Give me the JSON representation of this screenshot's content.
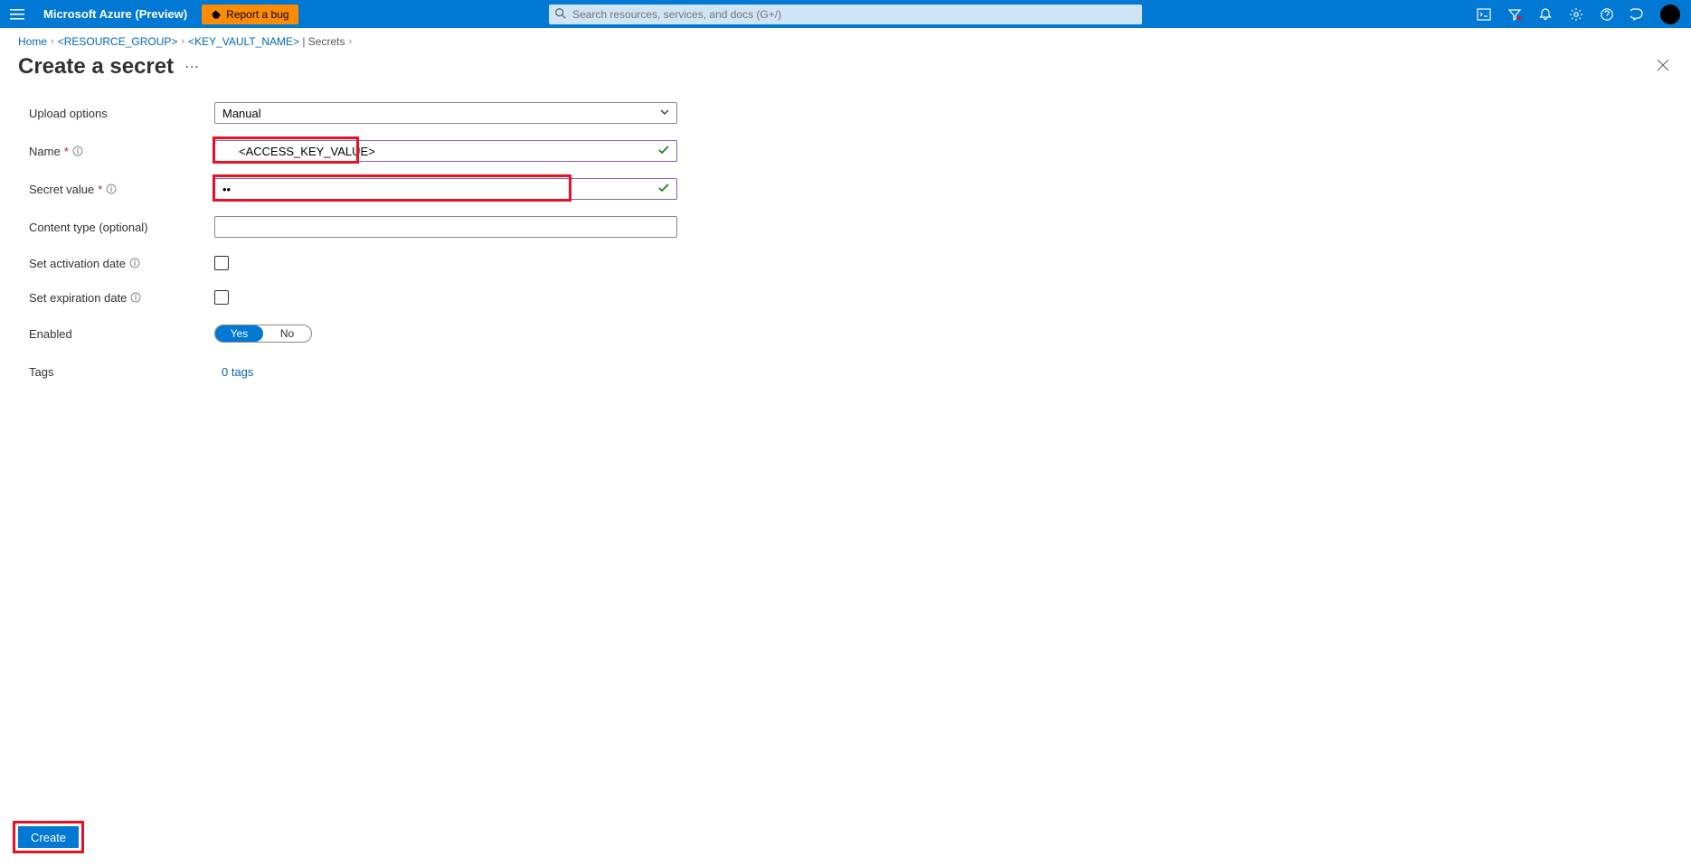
{
  "header": {
    "brand": "Microsoft Azure (Preview)",
    "report_bug": "Report a bug",
    "search_placeholder": "Search resources, services, and docs (G+/)"
  },
  "breadcrumb": {
    "home": "Home",
    "resource_group": "<RESOURCE_GROUP>",
    "key_vault": "<KEY_VAULT_NAME>",
    "secrets_suffix": " | Secrets"
  },
  "page": {
    "title": "Create a secret"
  },
  "form": {
    "upload_options_label": "Upload options",
    "upload_options_value": "Manual",
    "name_label": "Name",
    "name_value": "<ACCESS_KEY_VALUE>",
    "secret_value_label": "Secret value",
    "secret_value_value": "••",
    "content_type_label": "Content type (optional)",
    "content_type_value": "",
    "activation_label": "Set activation date",
    "expiration_label": "Set expiration date",
    "enabled_label": "Enabled",
    "enabled_yes": "Yes",
    "enabled_no": "No",
    "tags_label": "Tags",
    "tags_link": "0 tags"
  },
  "footer": {
    "create": "Create"
  }
}
